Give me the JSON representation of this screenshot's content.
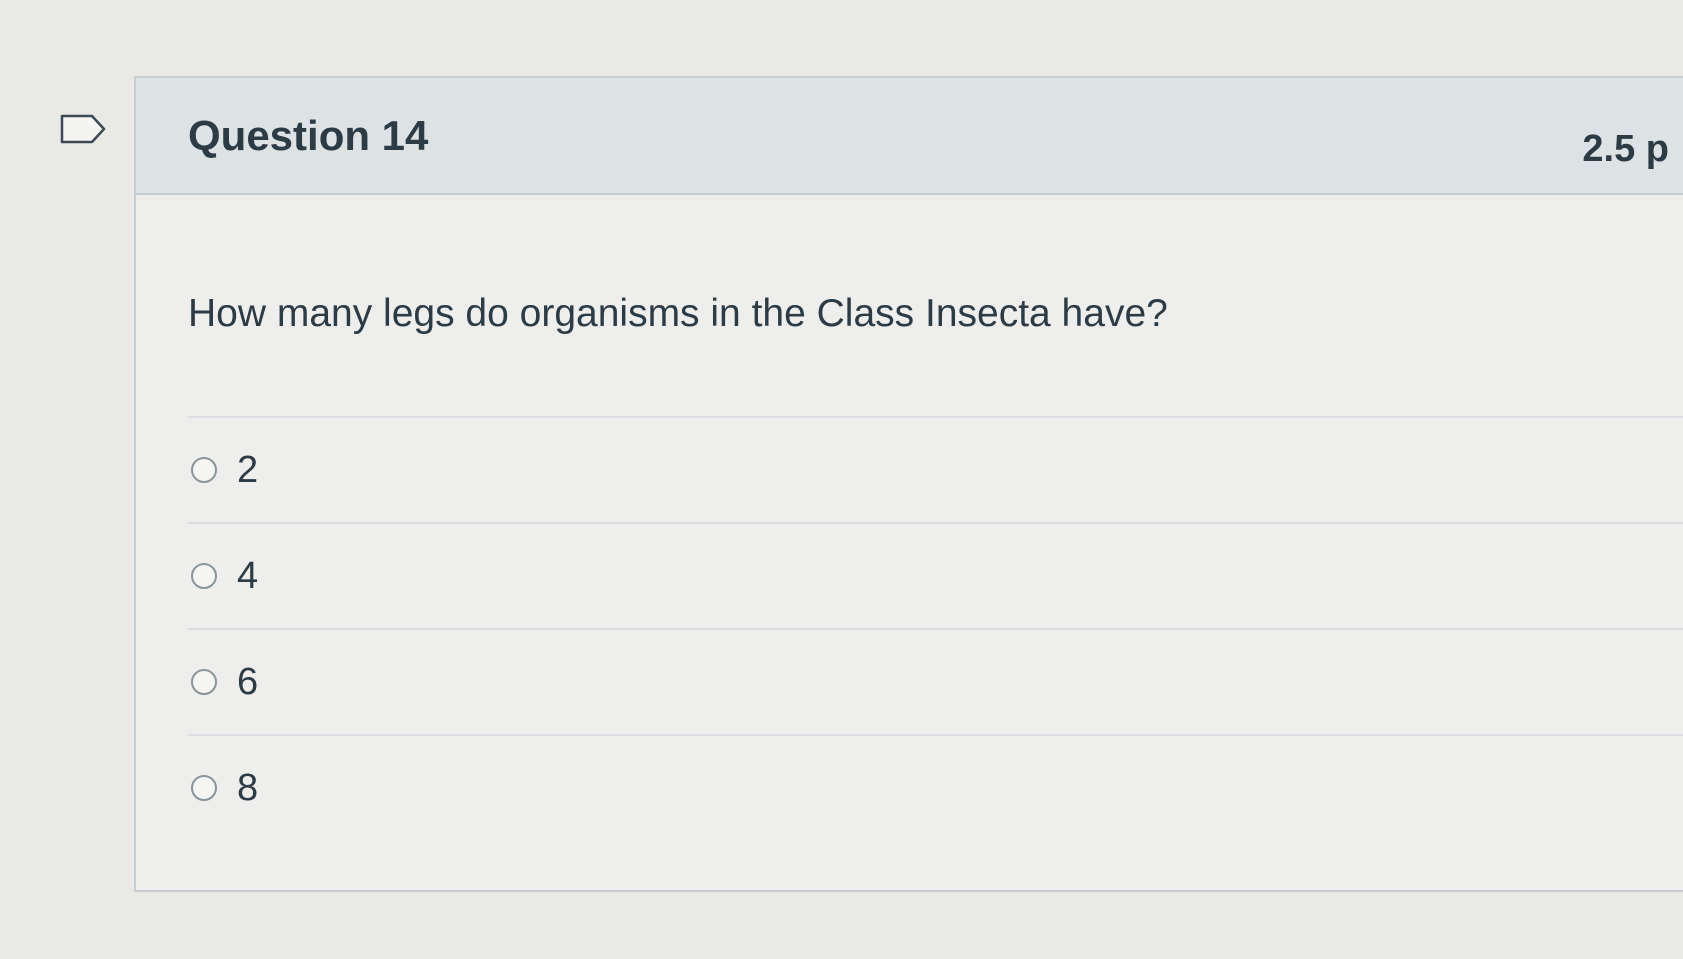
{
  "question": {
    "title": "Question 14",
    "points": "2.5 p",
    "text": "How many legs do organisms in the Class Insecta have?",
    "answers": [
      {
        "label": "2"
      },
      {
        "label": "4"
      },
      {
        "label": "6"
      },
      {
        "label": "8"
      }
    ]
  },
  "icons": {
    "flag": "flag-question-icon"
  }
}
